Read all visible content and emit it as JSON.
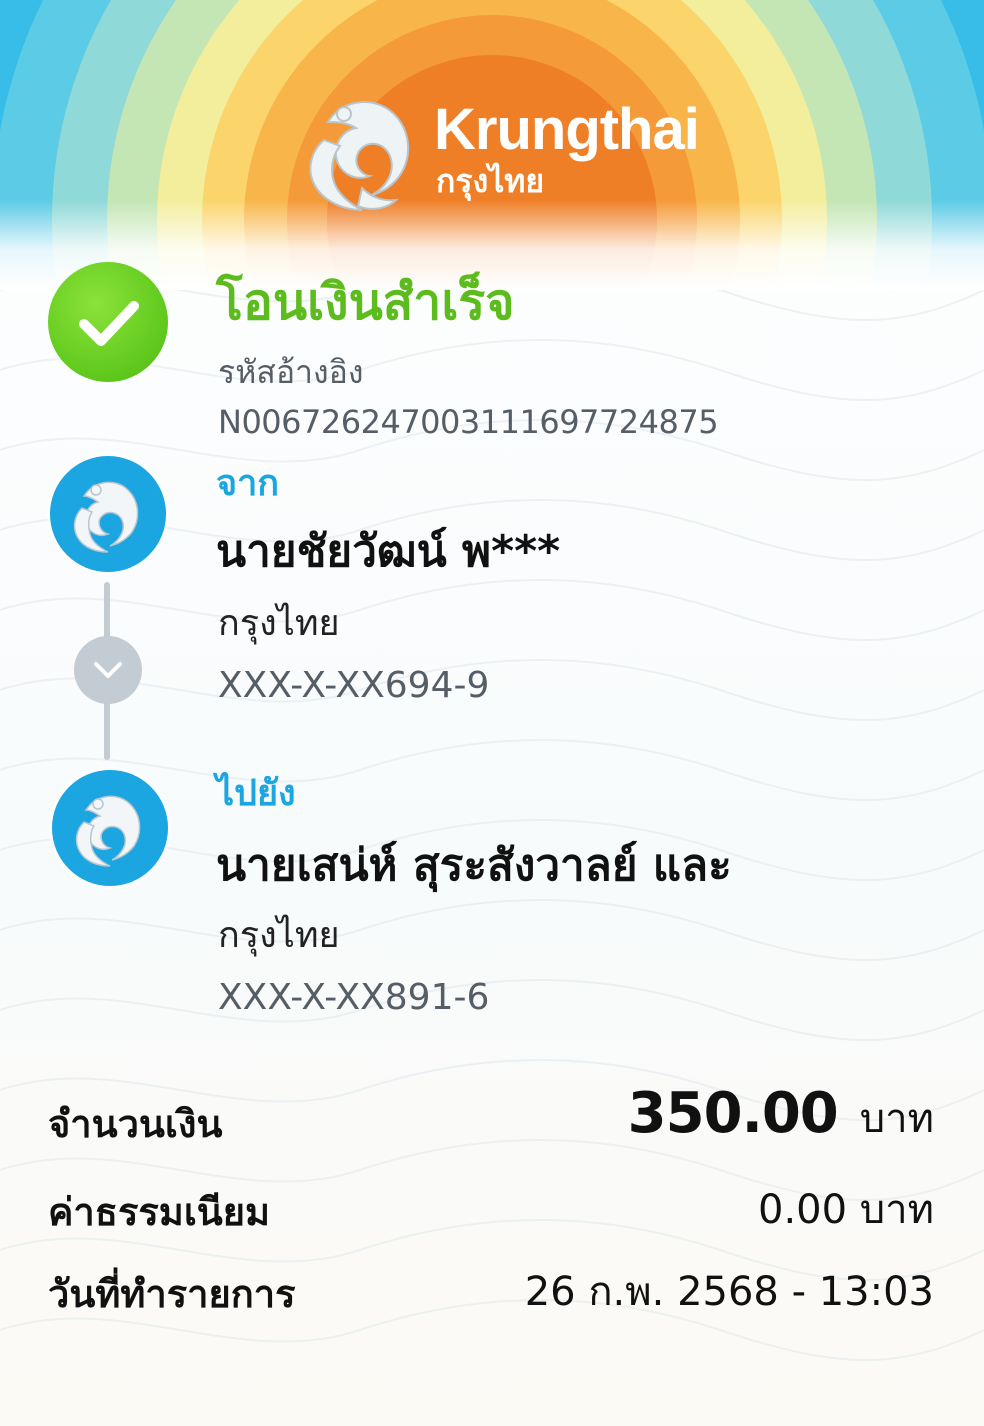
{
  "header": {
    "brand_en": "Krungthai",
    "brand_th": "กรุงไทย",
    "logo_icon": "krungthai-phoenix-icon"
  },
  "status": {
    "icon": "check-circle-icon",
    "title": "โอนเงินสำเร็จ",
    "ref_label": "รหัสอ้างอิง",
    "ref_value": "N006726247003111697724875"
  },
  "from": {
    "label": "จาก",
    "name": "นายชัยวัฒน์ พ***",
    "bank": "กรุงไทย",
    "account": "XXX-X-XX694-9"
  },
  "to": {
    "label": "ไปยัง",
    "name": "นายเสน่ห์ สุระสังวาลย์ และ",
    "bank": "กรุงไทย",
    "account": "XXX-X-XX891-6"
  },
  "summary": {
    "amount_label": "จำนวนเงิน",
    "amount_value": "350.00",
    "amount_unit": "บาท",
    "fee_label": "ค่าธรรมเนียม",
    "fee_value": "0.00 บาท",
    "date_label": "วันที่ทำรายการ",
    "date_value": "26 ก.พ. 2568 - 13:03"
  },
  "colors": {
    "success_green": "#5cbc1e",
    "bank_blue": "#1ba5e1",
    "connector_gray": "#c3ccd3",
    "muted_text": "#555e66"
  }
}
